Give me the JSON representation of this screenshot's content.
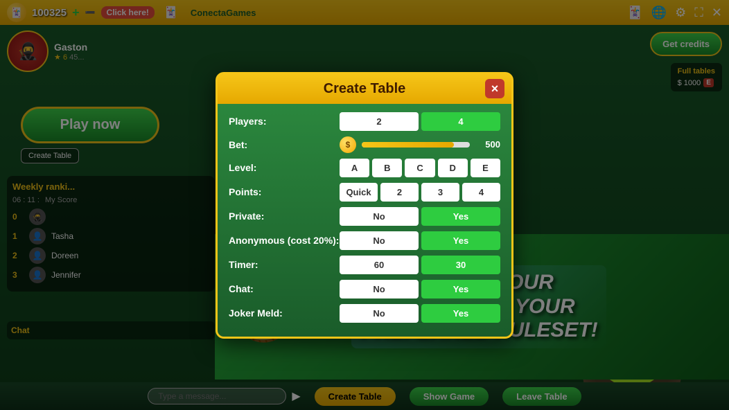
{
  "topbar": {
    "coin_symbol": "$",
    "score": "100325",
    "plus_btn": "+",
    "click_label": "Click here!",
    "logo": "ConectaGames"
  },
  "modal": {
    "title": "Create Table",
    "close_label": "×",
    "fields": {
      "players": {
        "label": "Players:",
        "options": [
          "2",
          "4"
        ],
        "active": "4"
      },
      "bet": {
        "label": "Bet:",
        "value": "500",
        "slider_pct": 85
      },
      "level": {
        "label": "Level:",
        "options": [
          "A",
          "B",
          "C",
          "D",
          "E"
        ],
        "active": ""
      },
      "points": {
        "label": "Points:",
        "options": [
          "Quick",
          "2",
          "3",
          "4"
        ],
        "active": ""
      },
      "private": {
        "label": "Private:",
        "options": [
          "No",
          "Yes"
        ],
        "active": "Yes"
      },
      "anonymous": {
        "label": "Anonymous (cost 20%):",
        "options": [
          "No",
          "Yes"
        ],
        "active": "Yes"
      },
      "timer": {
        "label": "Timer:",
        "options": [
          "60",
          "30"
        ],
        "active": "30"
      },
      "chat": {
        "label": "Chat:",
        "options": [
          "No",
          "Yes"
        ],
        "active": "Yes"
      },
      "joker_meld": {
        "label": "Joker Meld:",
        "options": [
          "No",
          "Yes"
        ],
        "active": "Yes"
      }
    }
  },
  "promo": {
    "line1": "CREATE YOUR",
    "line2": "TABLE WITH YOUR",
    "line3": "PREFERRED RULESET!"
  },
  "right_panel": {
    "get_credits_label": "Get credits",
    "full_tables_label": "Full tables",
    "table_value": "$ 1000"
  },
  "left_panel": {
    "player_name": "Gaston",
    "level": "6",
    "play_now": "Play now",
    "create_table": "Create Table",
    "weekly_title": "Weekly ranki...",
    "timer": "06 : 11 :",
    "my_score": "My Score",
    "rank_0": "0",
    "players": [
      {
        "rank": "1",
        "name": "Tasha"
      },
      {
        "rank": "2",
        "name": "Doreen"
      },
      {
        "rank": "3",
        "name": "Jennifer"
      }
    ],
    "chat_title": "Chat"
  },
  "bottom": {
    "create_table_btn": "Create Table",
    "show_game_btn": "Show Game",
    "leave_table_btn": "Leave Table"
  },
  "icons": {
    "cards": "🃏",
    "globe": "🌐",
    "gear": "⚙",
    "fullscreen": "⛶",
    "close": "✕",
    "star": "★",
    "trophy": "🏆"
  }
}
